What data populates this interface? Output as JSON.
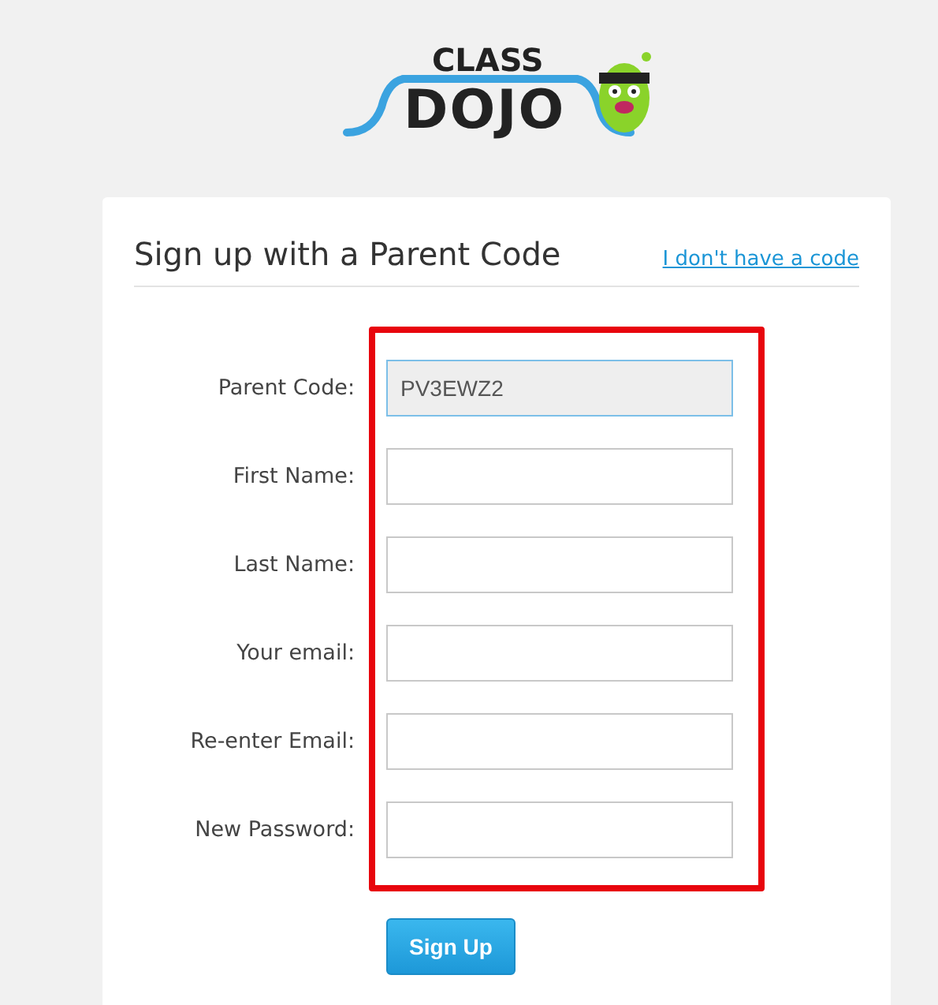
{
  "logo": {
    "top": "CLASS",
    "bottom": "DOJO"
  },
  "title": "Sign up with a Parent Code",
  "link": "I don't have a code",
  "fields": [
    {
      "label": "Parent Code:",
      "value": "PV3EWZ2",
      "disabled": true
    },
    {
      "label": "First Name:",
      "disabled": false
    },
    {
      "label": "Last Name:",
      "disabled": false
    },
    {
      "label": "Your email:",
      "disabled": false
    },
    {
      "label": "Re-enter Email:",
      "disabled": false
    },
    {
      "label": "New Password:",
      "disabled": false
    }
  ],
  "button": "Sign Up"
}
